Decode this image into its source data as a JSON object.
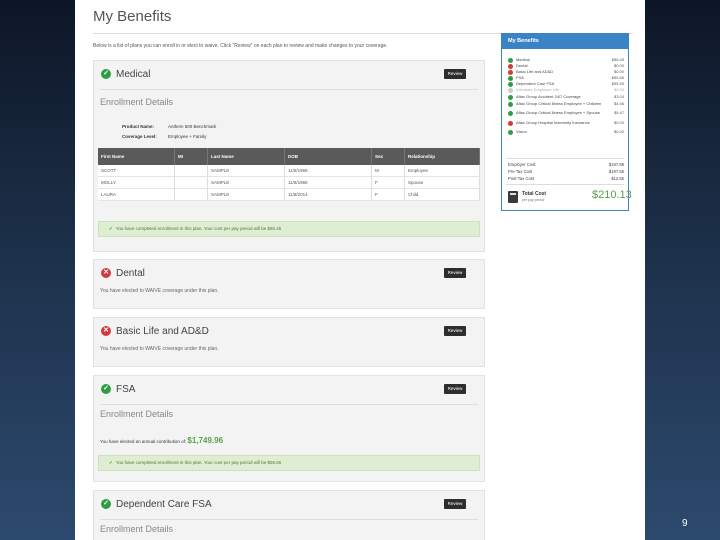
{
  "page": {
    "title": "My Benefits",
    "intro": "Below is a list of plans you can enroll in or elect to waive. Click \"Review\" on each plan to review and make changes to your coverage."
  },
  "cards": {
    "medical": {
      "title": "Medical",
      "button": "Review",
      "section": "Enrollment Details",
      "product_label": "Product Name:",
      "product_value": "Anthem 500 Benchmark",
      "coverage_label": "Coverage Level:",
      "coverage_value": "Employee + Family",
      "table": {
        "headers": [
          "First Name",
          "MI",
          "Last Name",
          "DOB",
          "Sex",
          "Relationship"
        ],
        "rows": [
          [
            "SCOTT",
            "",
            "SAMPLE",
            "11/6/1966",
            "M",
            "Employee"
          ],
          [
            "MOLLY",
            "",
            "SAMPLE",
            "11/8/1965",
            "F",
            "Spouse"
          ],
          [
            "LAURA",
            "",
            "SAMPLE",
            "11/9/2014",
            "F",
            "Child"
          ]
        ]
      },
      "success": "You have completed enrollment in this plan. Your cost per pay period will be $86.45"
    },
    "dental": {
      "title": "Dental",
      "button": "Review",
      "note": "You have elected to WAIVE coverage under this plan."
    },
    "basic_life": {
      "title": "Basic Life and AD&D",
      "button": "Review",
      "note": "You have elected to WAIVE coverage under this plan."
    },
    "fsa": {
      "title": "FSA",
      "button": "Review",
      "section": "Enrollment Details",
      "contrib_label": "You have elected an annual contribution of:",
      "contrib_value": "$1,749.96",
      "success": "You have completed enrollment in this plan. Your cost per pay period will be $55.56"
    },
    "dependent_care": {
      "title": "Dependent Care FSA",
      "button": "Review",
      "section": "Enrollment Details"
    }
  },
  "summary": {
    "title": "My Benefits",
    "items": [
      {
        "label": "Medical",
        "amount": "$86.45",
        "status": "ok"
      },
      {
        "label": "Dental",
        "amount": "$0.00",
        "status": "no"
      },
      {
        "label": "Basic Life and AD&D",
        "amount": "$0.00",
        "status": "no"
      },
      {
        "label": "FSA",
        "amount": "$55.56",
        "status": "ok"
      },
      {
        "label": "Dependent Care FSA",
        "amount": "$55.55",
        "status": "ok"
      },
      {
        "label": "Voluntary Employee Life",
        "amount": "$0.00",
        "status": "dim"
      },
      {
        "label": "Aflac Group Accident 24/7 Coverage",
        "amount": "$3.04",
        "status": "ok"
      },
      {
        "label": "Aflac Group Critical Illness Employee + Children",
        "amount": "$4.56",
        "status": "ok"
      },
      {
        "label": "Aflac Group Critical Illness Employee + Spouse",
        "amount": "$5.47",
        "status": "ok"
      },
      {
        "label": "Aflac Group Hospital Indemnity Insurance",
        "amount": "$0.00",
        "status": "no"
      },
      {
        "label": "Vision",
        "amount": "$0.00",
        "status": "ok"
      }
    ],
    "totals": [
      {
        "label": "Employer Cost",
        "amount": "$187.88"
      },
      {
        "label": "Pre-Tax Cost",
        "amount": "$197.58"
      },
      {
        "label": "Post-Tax Cost",
        "amount": "$12.55"
      }
    ],
    "total_label": "Total Cost",
    "total_sub": "per pay period",
    "total_amount": "$210.13"
  },
  "slide_number": "9",
  "colors": {
    "accent": "#3a84c6",
    "success": "#2e9e44",
    "waive": "#d23b3b",
    "amount": "#5aa04c"
  }
}
